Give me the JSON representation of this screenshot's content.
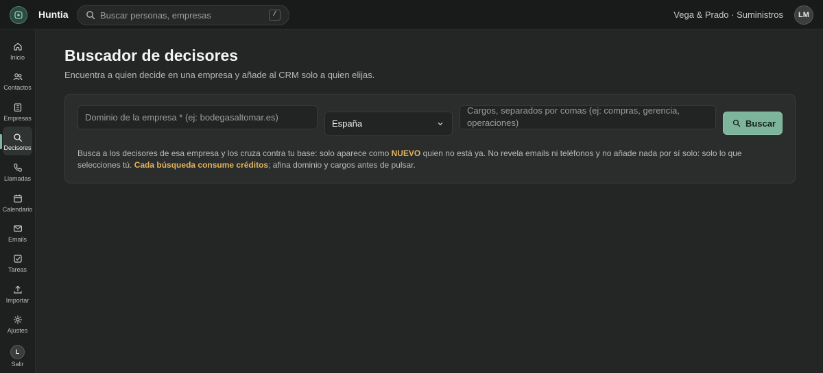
{
  "app": {
    "name": "Huntia",
    "org": "Vega & Prado · Suministros",
    "user_initials": "LM"
  },
  "search": {
    "placeholder": "Buscar personas, empresas",
    "shortcut": "/"
  },
  "sidebar": {
    "items": [
      {
        "label": "Inicio",
        "icon": "home-icon"
      },
      {
        "label": "Contactos",
        "icon": "users-icon"
      },
      {
        "label": "Empresas",
        "icon": "building-icon"
      },
      {
        "label": "Decisores",
        "icon": "search-icon",
        "active": true
      },
      {
        "label": "Llamadas",
        "icon": "phone-icon"
      },
      {
        "label": "Calendario",
        "icon": "calendar-icon"
      },
      {
        "label": "Emails",
        "icon": "mail-icon"
      },
      {
        "label": "Tareas",
        "icon": "checkbox-icon"
      },
      {
        "label": "Importar",
        "icon": "upload-icon"
      },
      {
        "label": "Ajustes",
        "icon": "gear-icon"
      }
    ],
    "logout": {
      "label": "Salir",
      "initial": "L"
    }
  },
  "page": {
    "title": "Buscador de decisores",
    "subtitle": "Encuentra a quien decide en una empresa y añade al CRM solo a quien elijas."
  },
  "form": {
    "domain_placeholder": "Dominio de la empresa * (ej: bodegasaltomar.es)",
    "country_value": "España",
    "roles_placeholder": "Cargos, separados por comas (ej: compras, gerencia, operaciones)",
    "submit_label": "Buscar"
  },
  "help": {
    "part1": "Busca a los decisores de esa empresa y los cruza contra tu base: solo aparece como ",
    "highlight_nuevo": "NUEVO",
    "part2": " quien no está ya. No revela emails ni teléfonos y no añade nada por sí solo: solo lo que selecciones tú. ",
    "highlight_credits": "Cada búsqueda consume créditos",
    "part3": "; afina dominio y cargos antes de pulsar."
  },
  "colors": {
    "accent": "#7cb59b",
    "highlight": "#e2b45e",
    "background": "#242625"
  }
}
